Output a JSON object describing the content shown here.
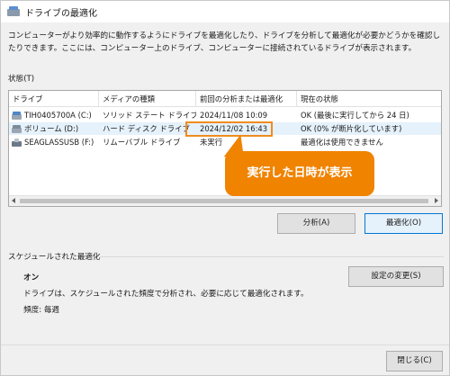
{
  "window": {
    "title": "ドライブの最適化",
    "icon": "defrag-icon"
  },
  "description": "コンピューターがより効率的に動作するようにドライブを最適化したり、ドライブを分析して最適化が必要かどうかを確認したりできます。ここには、コンピューター上のドライブ、コンピューターに接続されているドライブが表示されます。",
  "status": {
    "label": "状態(T)",
    "columns": [
      "ドライブ",
      "メディアの種類",
      "前回の分析または最適化",
      "現在の状態"
    ],
    "rows": [
      {
        "drive": "TIH0405700A (C:)",
        "media": "ソリッド ステート ドライブ",
        "last": "2024/11/08 10:09",
        "state": "OK (最後に実行してから 24 日)",
        "icon": "ssd-drive-icon"
      },
      {
        "drive": "ボリューム (D:)",
        "media": "ハード ディスク ドライブ",
        "last": "2024/12/02 16:43",
        "state": "OK (0% が断片化しています)",
        "icon": "hdd-drive-icon"
      },
      {
        "drive": "SEAGLASSUSB (F:)",
        "media": "リムーバブル ドライブ",
        "last": "未実行",
        "state": "最適化は使用できません",
        "icon": "usb-drive-icon"
      }
    ]
  },
  "callout": {
    "text": "実行した日時が表示",
    "color": "#f08300"
  },
  "buttons": {
    "analyze": "分析(A)",
    "optimize": "最適化(O)",
    "change_settings": "設定の変更(S)",
    "close": "閉じる(C)"
  },
  "schedule": {
    "label": "スケジュールされた最適化",
    "state": "オン",
    "description": "ドライブは、スケジュールされた頻度で分析され、必要に応じて最適化されます。",
    "frequency": "頻度: 毎週"
  },
  "colors": {
    "accent": "#0078d7",
    "highlight": "#f08c1e",
    "selected_row": "#e5f1fb"
  }
}
